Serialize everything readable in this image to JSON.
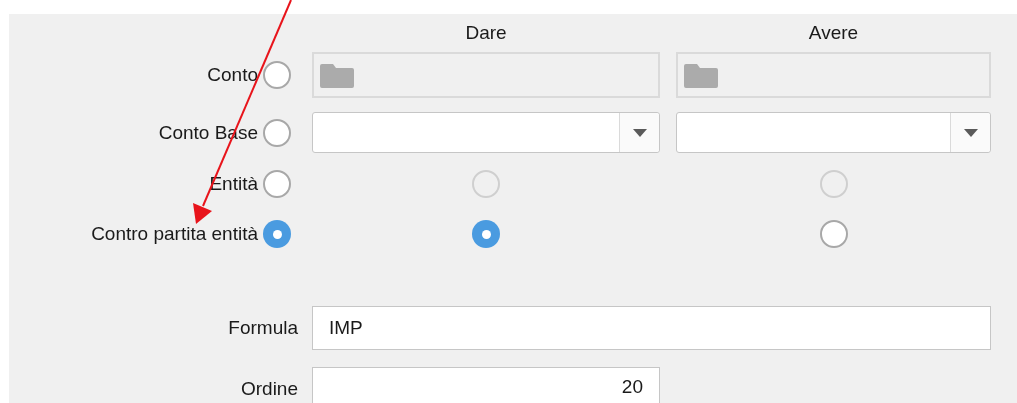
{
  "columns": [
    "Dare",
    "Avere"
  ],
  "rows": [
    {
      "kind": "folder",
      "label": "Conto",
      "selected": false
    },
    {
      "kind": "dropdown",
      "label": "Conto Base",
      "selected": false
    },
    {
      "kind": "radio",
      "label": "Entità",
      "selected": false,
      "dare": {
        "selected": false,
        "disabled": true
      },
      "avere": {
        "selected": false,
        "disabled": true
      }
    },
    {
      "kind": "radio",
      "label": "Contro partita entità",
      "selected": true,
      "dare": {
        "selected": true,
        "disabled": false
      },
      "avere": {
        "selected": false,
        "disabled": false
      }
    }
  ],
  "fields": [
    {
      "kind": "text",
      "label": "Formula",
      "value": "IMP"
    },
    {
      "kind": "number",
      "label": "Ordine",
      "value": "20"
    }
  ]
}
